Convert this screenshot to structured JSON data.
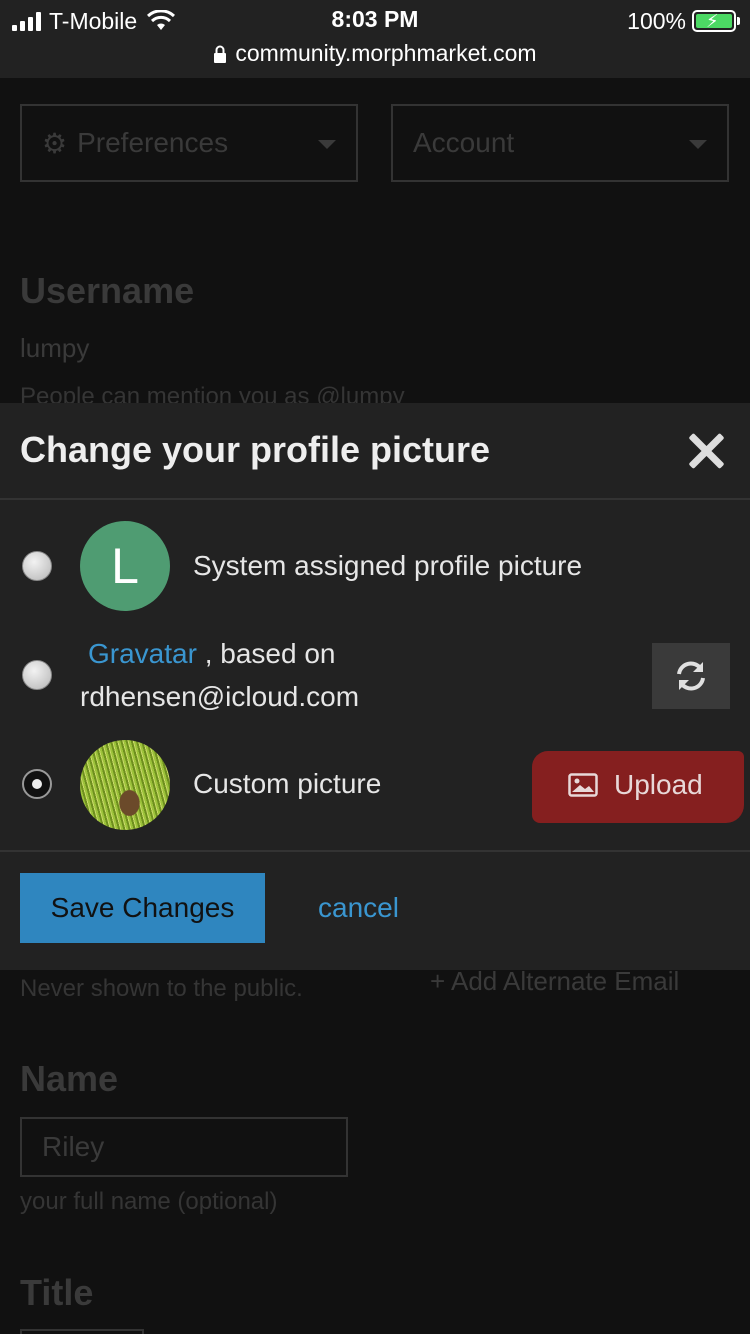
{
  "status_bar": {
    "carrier": "T-Mobile",
    "time": "8:03 PM",
    "battery": "100%",
    "url": "community.morphmarket.com"
  },
  "background": {
    "preferences_label": "Preferences",
    "account_label": "Account",
    "username_heading": "Username",
    "username_value": "lumpy",
    "mention_text": "People can mention you as @lumpy",
    "email_note": "Never shown to the public.",
    "add_email": "+ Add Alternate Email",
    "name_heading": "Name",
    "name_value": "Riley",
    "name_help": "your full name (optional)",
    "title_heading": "Title"
  },
  "modal": {
    "title": "Change your profile picture",
    "options": [
      {
        "avatar_letter": "L",
        "label": "System assigned profile picture",
        "selected": false
      },
      {
        "link": "Gravatar",
        "label_suffix": ", based on",
        "email": "rdhensen@icloud.com",
        "selected": false
      },
      {
        "label": "Custom picture",
        "selected": true
      }
    ],
    "upload_label": "Upload",
    "save_label": "Save Changes",
    "cancel_label": "cancel"
  }
}
